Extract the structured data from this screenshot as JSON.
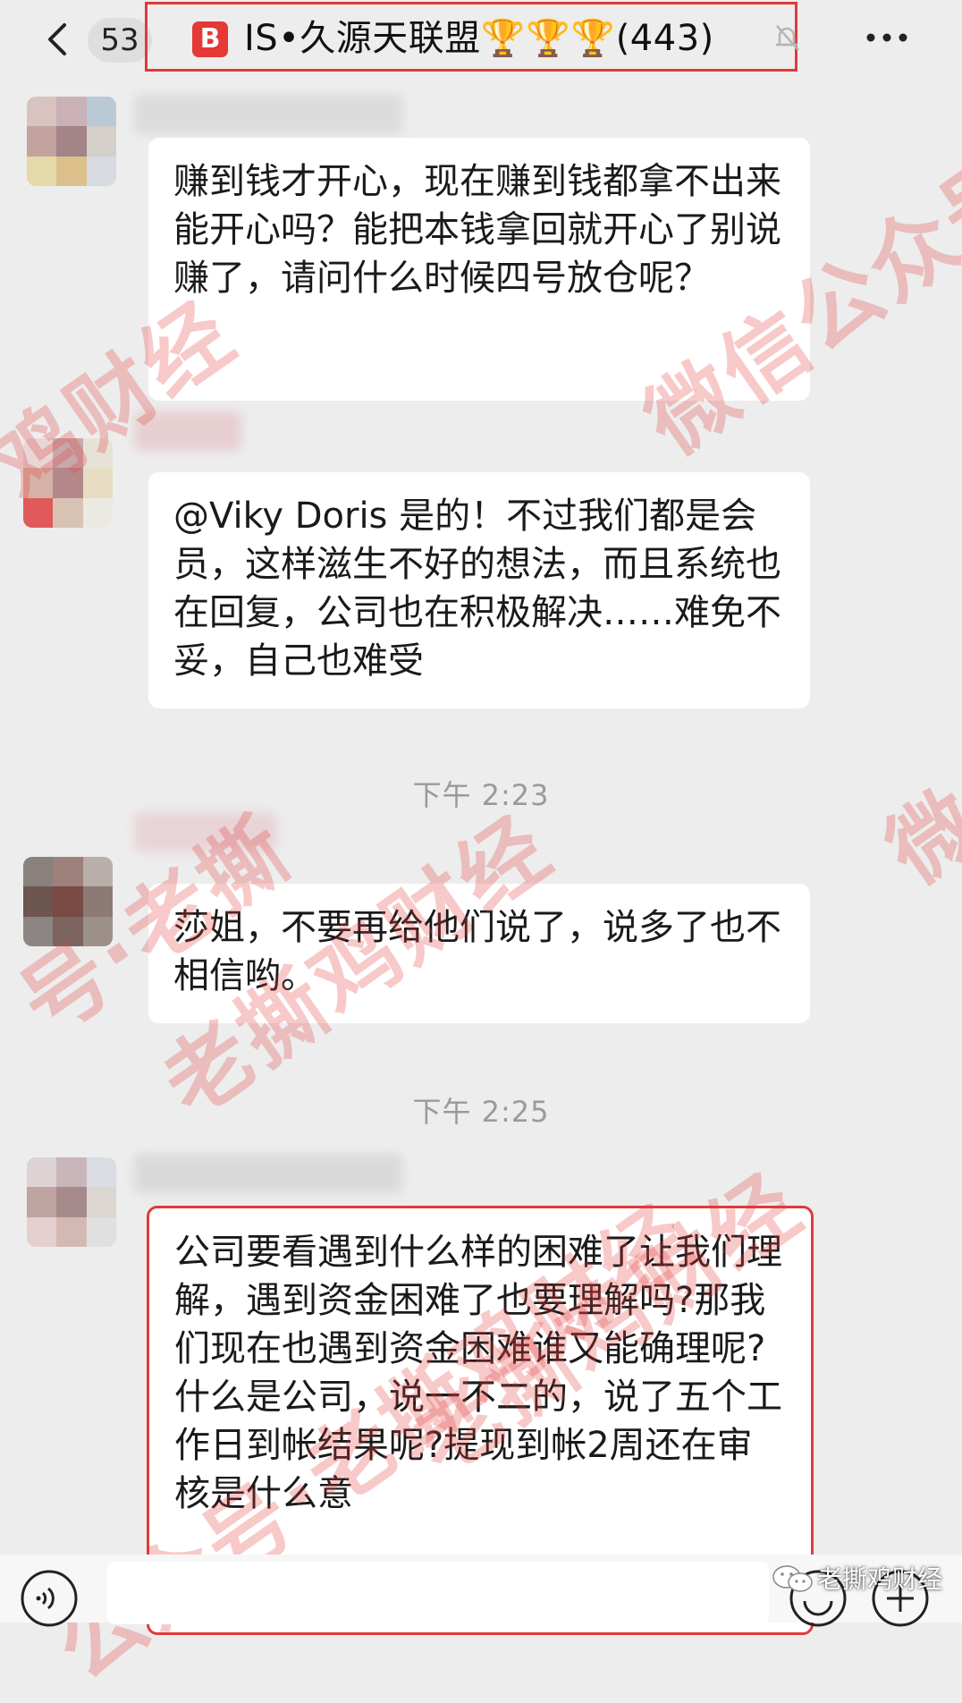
{
  "header": {
    "unread_count": "53",
    "group_badge": "B",
    "group_name": "IS•久源天联盟🏆🏆🏆(443)"
  },
  "messages": [
    {
      "text": "赚到钱才开心，现在赚到钱都拿不出来能开心吗？能把本钱拿回就开心了别说赚了，请问什么时候四号放仓呢？"
    },
    {
      "text": "@Viky Doris 是的！不过我们都是会员，这样滋生不好的想法，而且系统也在回复，公司也在积极解决……难免不妥，自己也难受"
    },
    {
      "text": "莎姐，不要再给他们说了，说多了也不相信哟。"
    },
    {
      "text": "公司要看遇到什么样的困难了让我们理解，遇到资金困难了也要理解吗?那我们现在也遇到资金困难谁又能确理呢?什么是公司，说一不二的，说了五个工作日到帐结果呢?提现到帐2周还在审核是什么意"
    }
  ],
  "timestamps": {
    "t1": "下午 2:23",
    "t2": "下午 2:25"
  },
  "watermarks": {
    "w1": "微信公众号",
    "w2": "鸡财经",
    "w3": "老撕鸡财经",
    "w4": "微信",
    "w5": "公众号·老撕鸡财经",
    "w6": "号·老撕",
    "w7": "老撕鸡财经"
  },
  "source_mark": "老撕鸡财经",
  "colors": {
    "highlight_border": "#e03a3a",
    "chat_background": "#ededed",
    "bubble": "#ffffff",
    "timestamp_text": "#9a9a9a",
    "watermark": "#e23c3c"
  }
}
